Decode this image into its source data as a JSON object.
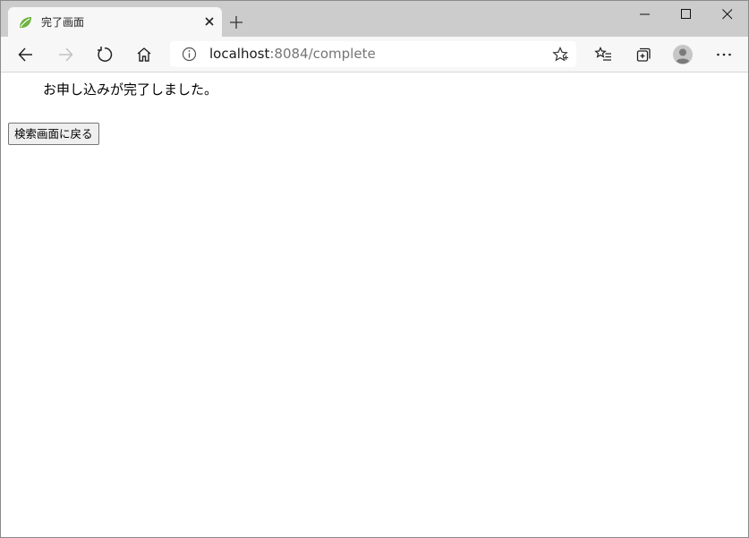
{
  "browser": {
    "tab": {
      "title": "完了画面",
      "favicon": "spring-leaf-icon"
    },
    "address_bar": {
      "host": "localhost",
      "path": ":8084/complete"
    },
    "colors": {
      "titlebar": "#cccccc",
      "toolbar": "#f7f7f7",
      "favicon_green": "#6db33f"
    }
  },
  "page": {
    "message": "お申し込みが完了しました。",
    "back_button_label": "検索画面に戻る"
  }
}
